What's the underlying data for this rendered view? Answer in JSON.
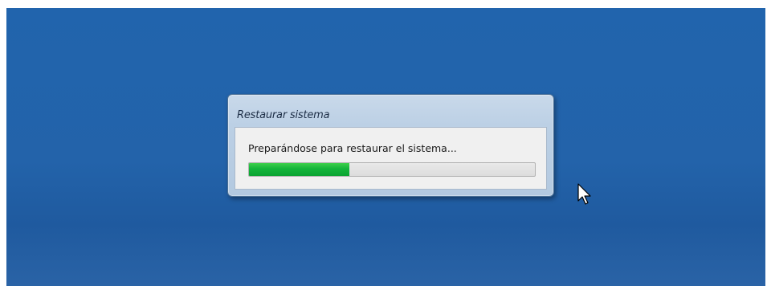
{
  "dialog": {
    "title": "Restaurar sistema",
    "message": "Preparándose para restaurar el sistema...",
    "progress": 0.35
  },
  "colors": {
    "desktop_background": "#2164ad",
    "progress_fill": "#14b43a"
  },
  "pointer": {
    "icon": "mouse-pointer-icon"
  }
}
